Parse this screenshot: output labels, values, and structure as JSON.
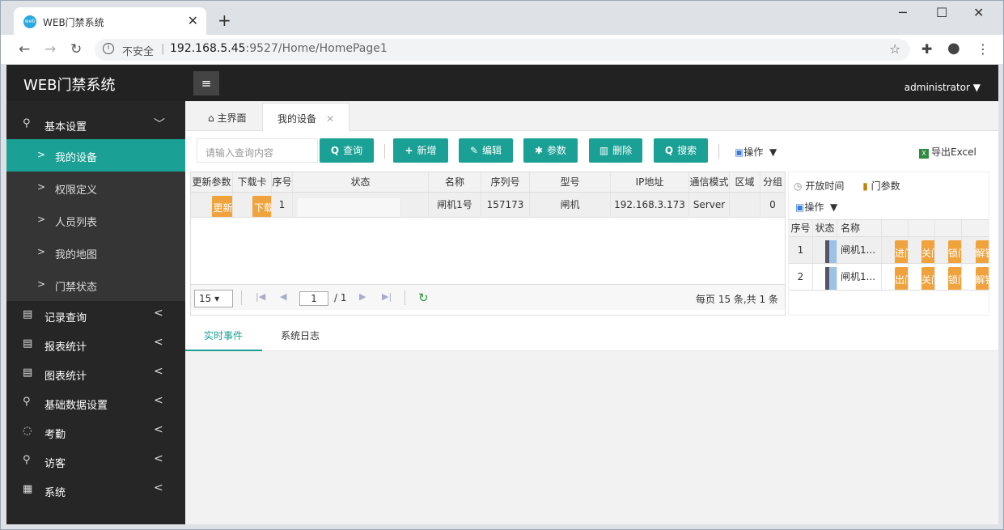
{
  "browser": {
    "tab_title": "WEB门禁系统",
    "tab_close": "✕",
    "new_tab": "+",
    "favicon_text": "web",
    "controls": {
      "minimize": "─",
      "maximize": "☐",
      "close": "✕"
    },
    "nav": {
      "back": "←",
      "forward": "→",
      "reload": "↻"
    },
    "security_icon": "i",
    "security_label": "不安全",
    "separator": "|",
    "url_host": "192.168.5.45",
    "url_path": ":9527/Home/HomePage1",
    "star": "☆",
    "extensions": "✚",
    "profile": "●",
    "menu": "⋮"
  },
  "app": {
    "brand": "WEB门禁系统",
    "hamburger": "≡",
    "user": "administrator ▼",
    "accent_color": "#1aa094",
    "orange_color": "#f0a33c"
  },
  "sidebar": {
    "basic": {
      "icon": "⚲",
      "label": "基本设置",
      "arrow": "﹀"
    },
    "sub_chevron": ">",
    "sub_items": [
      {
        "label": "我的设备"
      },
      {
        "label": "权限定义"
      },
      {
        "label": "人员列表"
      },
      {
        "label": "我的地图"
      },
      {
        "label": "门禁状态"
      }
    ],
    "items": [
      {
        "label": "记录查询",
        "icon": "▤"
      },
      {
        "label": "报表统计",
        "icon": "▤"
      },
      {
        "label": "图表统计",
        "icon": "▤"
      },
      {
        "label": "基础数据设置",
        "icon": "⚲"
      },
      {
        "label": "考勤",
        "icon": "◌"
      },
      {
        "label": "访客",
        "icon": "⚲"
      },
      {
        "label": "系统",
        "icon": "▦"
      }
    ],
    "collapse_arrow": "<"
  },
  "page_tabs": {
    "home_icon": "⌂",
    "home": "主界面",
    "devices": "我的设备",
    "close": "✕"
  },
  "toolbar": {
    "search_placeholder": "请输入查询内容",
    "query": "查询",
    "query_icon": "Q",
    "add": "新增",
    "add_icon": "+",
    "edit": "编辑",
    "edit_icon": "✎",
    "params": "参数",
    "params_icon": "✱",
    "delete": "删除",
    "delete_icon": "▥",
    "search": "搜索",
    "search_icon": "Q",
    "ops": "操作",
    "ops_icon": "▣",
    "ops_arrow": "▼",
    "export": "导出Excel",
    "export_icon": "X"
  },
  "grid": {
    "columns": [
      "更新参数",
      "下载卡",
      "序号",
      "状态",
      "名称",
      "序列号",
      "型号",
      "IP地址",
      "通信模式",
      "区域",
      "分组"
    ],
    "row": {
      "update_btn": "更新参数",
      "download_btn": "下载卡",
      "seq": "1",
      "name": "闸机1号",
      "serial": "157173",
      "model": "闸机",
      "ip": "192.168.3.173",
      "comm": "Server",
      "area": "",
      "group": "0"
    },
    "pager": {
      "page_size": "15 ▾",
      "first": "|◀",
      "prev": "◀",
      "current": "1",
      "total": "/ 1",
      "next": "▶",
      "last": "▶|",
      "refresh": "↻",
      "info": "每页 15 条,共 1 条"
    }
  },
  "right_panel": {
    "open_time": "开放时间",
    "open_time_icon": "◷",
    "door_params": "门参数",
    "door_params_icon": "▮",
    "ops": "操作",
    "ops_icon": "▣",
    "ops_arrow": "▼",
    "columns": [
      "序号",
      "状态",
      "名称"
    ],
    "rows": [
      {
        "seq": "1",
        "name": "闸机1...",
        "btns": [
          "进门",
          "关门",
          "锁门",
          "解锁"
        ]
      },
      {
        "seq": "2",
        "name": "闸机1...",
        "btns": [
          "出门",
          "关门",
          "锁门",
          "解锁"
        ]
      }
    ]
  },
  "bottom_tabs": [
    "实时事件",
    "系统日志"
  ]
}
